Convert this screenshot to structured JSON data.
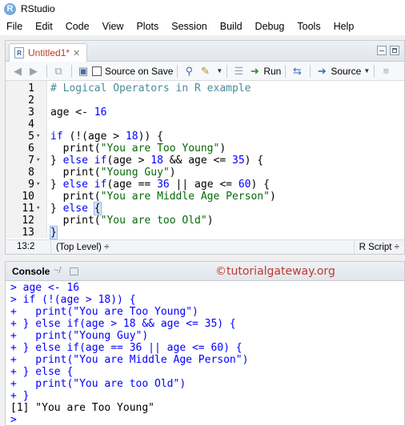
{
  "app": {
    "title": "RStudio",
    "logo_letter": "R"
  },
  "menu": [
    "File",
    "Edit",
    "Code",
    "View",
    "Plots",
    "Session",
    "Build",
    "Debug",
    "Tools",
    "Help"
  ],
  "editor": {
    "tab_label": "Untitled1*",
    "tab_icon": "r-file-icon",
    "toolbar": {
      "source_on_save": "Source on Save",
      "run": "Run",
      "source": "Source"
    },
    "lines": [
      {
        "n": "1",
        "fold": "",
        "tokens": [
          {
            "t": "# Logical Operators in R example",
            "c": "c-comment"
          }
        ]
      },
      {
        "n": "2",
        "fold": "",
        "tokens": []
      },
      {
        "n": "3",
        "fold": "",
        "tokens": [
          {
            "t": "age <- ",
            "c": "c-plain"
          },
          {
            "t": "16",
            "c": "c-num"
          }
        ]
      },
      {
        "n": "4",
        "fold": "",
        "tokens": []
      },
      {
        "n": "5",
        "fold": "▾",
        "tokens": [
          {
            "t": "if",
            "c": "c-kw"
          },
          {
            "t": " (!(age > ",
            "c": "c-plain"
          },
          {
            "t": "18",
            "c": "c-num"
          },
          {
            "t": ")) {",
            "c": "c-plain"
          }
        ]
      },
      {
        "n": "6",
        "fold": "",
        "tokens": [
          {
            "t": "  print(",
            "c": "c-plain"
          },
          {
            "t": "\"You are Too Young\"",
            "c": "c-str"
          },
          {
            "t": ")",
            "c": "c-plain"
          }
        ]
      },
      {
        "n": "7",
        "fold": "▾",
        "tokens": [
          {
            "t": "} ",
            "c": "c-plain"
          },
          {
            "t": "else if",
            "c": "c-kw"
          },
          {
            "t": "(age > ",
            "c": "c-plain"
          },
          {
            "t": "18",
            "c": "c-num"
          },
          {
            "t": " && age <= ",
            "c": "c-plain"
          },
          {
            "t": "35",
            "c": "c-num"
          },
          {
            "t": ") {",
            "c": "c-plain"
          }
        ]
      },
      {
        "n": "8",
        "fold": "",
        "tokens": [
          {
            "t": "  print(",
            "c": "c-plain"
          },
          {
            "t": "\"Young Guy\"",
            "c": "c-str"
          },
          {
            "t": ")",
            "c": "c-plain"
          }
        ]
      },
      {
        "n": "9",
        "fold": "▾",
        "tokens": [
          {
            "t": "} ",
            "c": "c-plain"
          },
          {
            "t": "else if",
            "c": "c-kw"
          },
          {
            "t": "(age == ",
            "c": "c-plain"
          },
          {
            "t": "36",
            "c": "c-num"
          },
          {
            "t": " || age <= ",
            "c": "c-plain"
          },
          {
            "t": "60",
            "c": "c-num"
          },
          {
            "t": ") {",
            "c": "c-plain"
          }
        ]
      },
      {
        "n": "10",
        "fold": "",
        "tokens": [
          {
            "t": "  print(",
            "c": "c-plain"
          },
          {
            "t": "\"You are Middle Age Person\"",
            "c": "c-str"
          },
          {
            "t": ")",
            "c": "c-plain"
          }
        ]
      },
      {
        "n": "11",
        "fold": "▾",
        "tokens": [
          {
            "t": "} ",
            "c": "c-plain"
          },
          {
            "t": "else",
            "c": "c-kw"
          },
          {
            "t": " ",
            "c": "c-plain"
          },
          {
            "t": "{",
            "c": "cursor-brace"
          }
        ]
      },
      {
        "n": "12",
        "fold": "",
        "tokens": [
          {
            "t": "  print(",
            "c": "c-plain"
          },
          {
            "t": "\"You are too Old\"",
            "c": "c-str"
          },
          {
            "t": ")",
            "c": "c-plain"
          }
        ]
      },
      {
        "n": "13",
        "fold": "",
        "tokens": [
          {
            "t": "}",
            "c": "cursor-brace"
          }
        ]
      }
    ],
    "status": {
      "position": "13:2",
      "scope": "(Top Level) ÷",
      "language": "R Script ÷"
    }
  },
  "console": {
    "title": "Console",
    "path": "~/",
    "watermark": "©tutorialgateway.org",
    "lines": [
      {
        "t": "> age <- 16",
        "kind": "in"
      },
      {
        "t": "> if (!(age > 18)) {",
        "kind": "in"
      },
      {
        "t": "+   print(\"You are Too Young\")",
        "kind": "in"
      },
      {
        "t": "+ } else if(age > 18 && age <= 35) {",
        "kind": "in"
      },
      {
        "t": "+   print(\"Young Guy\")",
        "kind": "in"
      },
      {
        "t": "+ } else if(age == 36 || age <= 60) {",
        "kind": "in"
      },
      {
        "t": "+   print(\"You are Middle Age Person\")",
        "kind": "in"
      },
      {
        "t": "+ } else {",
        "kind": "in"
      },
      {
        "t": "+   print(\"You are too Old\")",
        "kind": "in"
      },
      {
        "t": "+ }",
        "kind": "in"
      },
      {
        "t": "[1] \"You are Too Young\"",
        "kind": "out"
      },
      {
        "t": ">",
        "kind": "in"
      }
    ]
  }
}
